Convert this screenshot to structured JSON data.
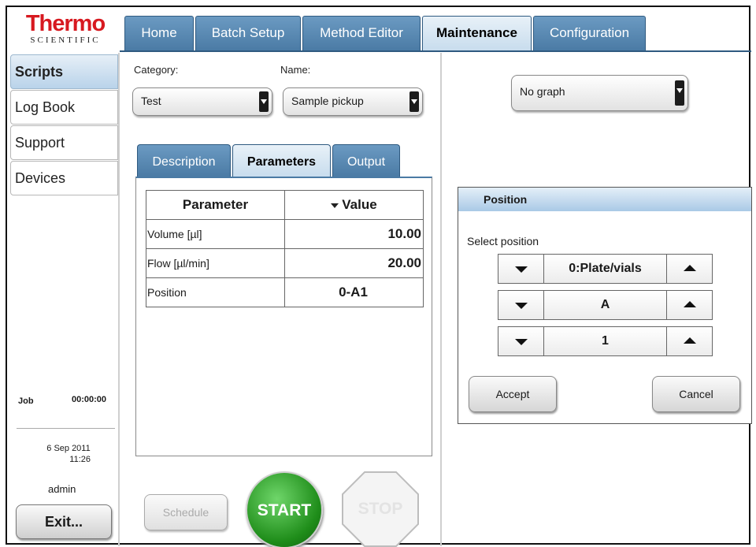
{
  "logo": {
    "brand": "Thermo",
    "sub": "SCIENTIFIC"
  },
  "top_tabs": [
    {
      "label": "Home",
      "active": false
    },
    {
      "label": "Batch Setup",
      "active": false
    },
    {
      "label": "Method Editor",
      "active": false
    },
    {
      "label": "Maintenance",
      "active": true
    },
    {
      "label": "Configuration",
      "active": false
    }
  ],
  "sidebar": {
    "items": [
      {
        "label": "Scripts",
        "active": true
      },
      {
        "label": "Log Book",
        "active": false
      },
      {
        "label": "Support",
        "active": false
      },
      {
        "label": "Devices",
        "active": false
      }
    ],
    "job_label": "Job",
    "job_time": "00:00:00",
    "date": "6 Sep 2011",
    "time": "11:26",
    "user": "admin",
    "exit_label": "Exit..."
  },
  "selectors": {
    "category_label": "Category:",
    "category_value": "Test",
    "name_label": "Name:",
    "name_value": "Sample pickup",
    "graph_value": "No graph"
  },
  "sub_tabs": [
    {
      "label": "Description",
      "active": false
    },
    {
      "label": "Parameters",
      "active": true
    },
    {
      "label": "Output",
      "active": false
    }
  ],
  "params_table": {
    "headers": [
      "Parameter",
      "Value"
    ],
    "rows": [
      {
        "name": "Volume [µl]",
        "value": "10.00"
      },
      {
        "name": "Flow [µl/min]",
        "value": "20.00"
      },
      {
        "name": "Position",
        "value": "0-A1"
      }
    ]
  },
  "actions": {
    "schedule": "Schedule",
    "start": "START",
    "stop": "STOP"
  },
  "position_dialog": {
    "title": "Position",
    "select_label": "Select position",
    "steppers": [
      "0:Plate/vials",
      "A",
      "1"
    ],
    "accept": "Accept",
    "cancel": "Cancel"
  },
  "colors": {
    "tab_blue": "#4a7aa4",
    "active_tab": "#c7dced",
    "brand_red": "#d71920",
    "start_green": "#1f8d1a"
  }
}
